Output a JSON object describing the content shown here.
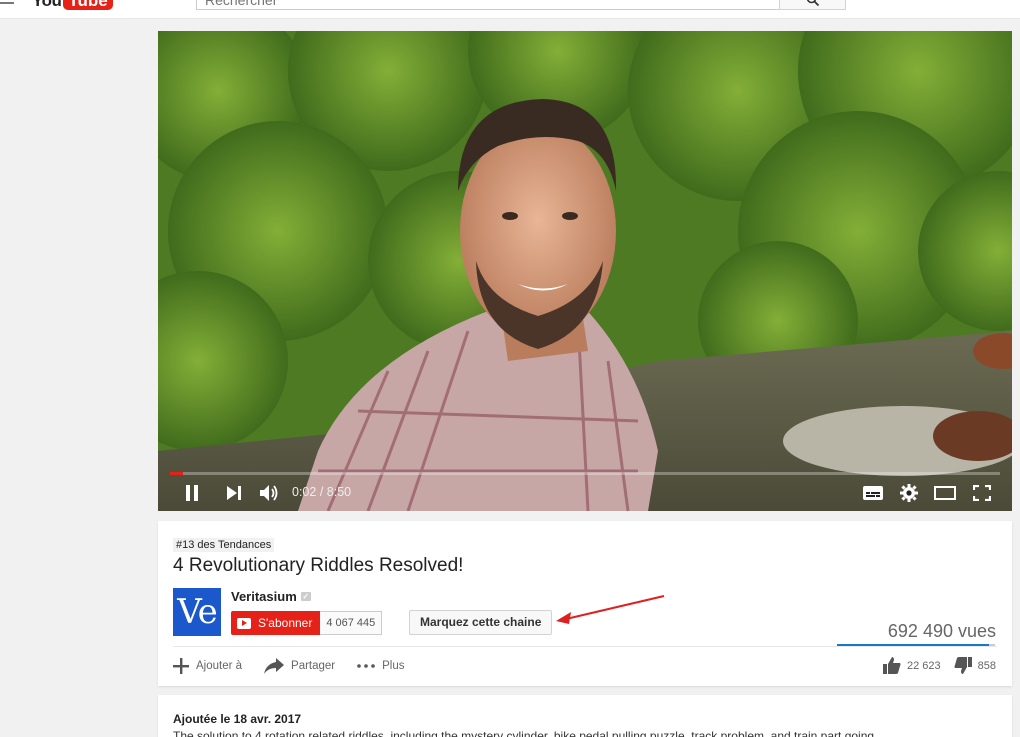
{
  "masthead": {
    "logo_you": "You",
    "logo_tube": "Tube",
    "search_placeholder": "Rechercher"
  },
  "player": {
    "time_current": "0:02",
    "time_separator": "/",
    "time_total": "8:50",
    "progress_fraction": 0.004
  },
  "video": {
    "trending_badge": "#13 des Tendances",
    "title": "4 Revolutionary Riddles Resolved!",
    "channel_name": "Veritasium",
    "avatar_text": "Ve",
    "subscribe_label": "S'abonner",
    "subscriber_count": "4 067 445",
    "mark_channel_label": "Marquez cette chaine",
    "views": "692 490 vues",
    "like_ratio": 0.963
  },
  "actions": {
    "add_to": "Ajouter à",
    "share": "Partager",
    "more": "Plus"
  },
  "rating": {
    "likes": "22 623",
    "dislikes": "858"
  },
  "description": {
    "published": "Ajoutée le 18 avr. 2017",
    "text": "The solution to 4 rotation related riddles, including the mystery cylinder, bike pedal pulling puzzle, track problem, and train part going"
  },
  "colors": {
    "brand_red": "#e62117",
    "avatar_blue": "#1a58cc",
    "like_bar_blue": "#167ac6",
    "annotation_arrow": "#e02020"
  }
}
